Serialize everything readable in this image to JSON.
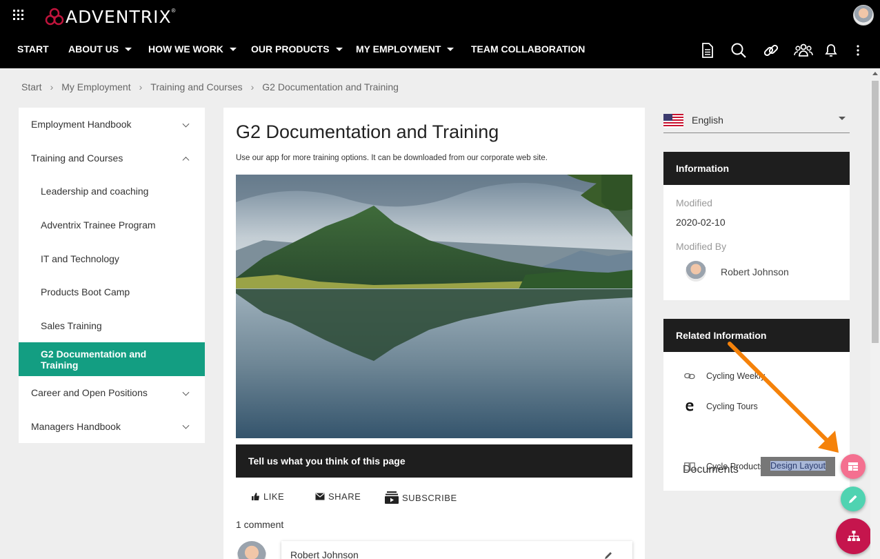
{
  "brand": {
    "name": "ADVENTRIX",
    "mark": "®"
  },
  "nav": {
    "items": [
      {
        "label": "START",
        "dropdown": false
      },
      {
        "label": "ABOUT US",
        "dropdown": true
      },
      {
        "label": "HOW WE WORK",
        "dropdown": true
      },
      {
        "label": "OUR PRODUCTS",
        "dropdown": true
      },
      {
        "label": "MY EMPLOYMENT",
        "dropdown": true
      },
      {
        "label": "TEAM COLLABORATION",
        "dropdown": false
      }
    ],
    "tools": [
      "document-icon",
      "search-icon",
      "link-icon",
      "people-icon",
      "bell-icon",
      "more-vertical-icon"
    ]
  },
  "breadcrumb": [
    "Start",
    "My Employment",
    "Training and Courses",
    "G2 Documentation and Training"
  ],
  "leftnav": {
    "items": [
      {
        "label": "Employment Handbook",
        "level": 0,
        "chevron": "down"
      },
      {
        "label": "Training and Courses",
        "level": 0,
        "chevron": "up"
      },
      {
        "label": "Leadership and coaching",
        "level": 1
      },
      {
        "label": "Adventrix Trainee Program",
        "level": 1
      },
      {
        "label": "IT and Technology",
        "level": 1
      },
      {
        "label": "Products Boot Camp",
        "level": 1
      },
      {
        "label": "Sales Training",
        "level": 1
      },
      {
        "label": "G2 Documentation and Training",
        "level": 1,
        "active": true
      },
      {
        "label": "Career and Open Positions",
        "level": 0,
        "chevron": "down"
      },
      {
        "label": "Managers Handbook",
        "level": 0,
        "chevron": "down"
      }
    ]
  },
  "article": {
    "title": "G2 Documentation and Training",
    "subtitle": "Use our app for more training options. It can be downloaded from our corporate web site.",
    "feedback": "Tell us what you think of this page",
    "actions": {
      "like": "LIKE",
      "share": "SHARE",
      "subscribe": "SUBSCRIBE"
    },
    "comments_count": "1 comment",
    "comment_author": "Robert Johnson"
  },
  "language": {
    "selected": "English"
  },
  "information": {
    "title": "Information",
    "modified_label": "Modified",
    "modified_value": "2020-02-10",
    "modified_by_label": "Modified By",
    "modified_by_value": "Robert Johnson"
  },
  "related": {
    "title": "Related Information",
    "links": [
      {
        "label": "Cycling Weekly",
        "icon": "link-icon"
      },
      {
        "label": "Cycling Tours",
        "icon": "edge-browser-icon"
      }
    ],
    "documents_title": "Documents",
    "documents": [
      {
        "label": "Cycle Products L",
        "icon": "book-icon"
      }
    ]
  },
  "tooltip": "Design Layout",
  "colors": {
    "accent": "#139e82",
    "header": "#000000",
    "panel_head": "#1e1e1e",
    "fab_layout": "#f47090",
    "fab_edit": "#4fd3b1",
    "fab_tree": "#c5154d",
    "arrow": "#f5820a"
  }
}
